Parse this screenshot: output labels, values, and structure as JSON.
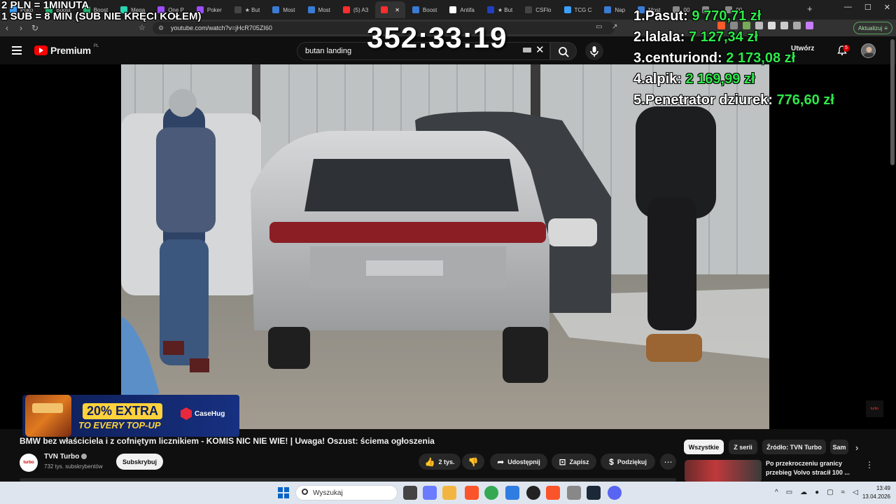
{
  "browser": {
    "tabs": [
      {
        "label": "Poko",
        "active": false,
        "color": "#3aa0ff"
      },
      {
        "label": "Boost",
        "active": false,
        "color": "#1db36a"
      },
      {
        "label": "Boost",
        "active": false,
        "color": "#1db36a"
      },
      {
        "label": "Mega",
        "active": false,
        "color": "#2ad4b0"
      },
      {
        "label": "One P",
        "active": false,
        "color": "#9b4dff"
      },
      {
        "label": "Poker",
        "active": false,
        "color": "#9b4dff"
      },
      {
        "label": "★ But",
        "active": false,
        "color": "#444444"
      },
      {
        "label": "Most",
        "active": false,
        "color": "#3a7bd5"
      },
      {
        "label": "Most",
        "active": false,
        "color": "#3a7bd5"
      },
      {
        "label": "(5) A3",
        "active": false,
        "color": "#ff2d2d"
      },
      {
        "label": "",
        "active": true,
        "color": "#ff2d2d"
      },
      {
        "label": "Boost",
        "active": false,
        "color": "#3a7bd5"
      },
      {
        "label": "Antifa",
        "active": false,
        "color": "#ffffff"
      },
      {
        "label": "★ But",
        "active": false,
        "color": "#2040c0"
      },
      {
        "label": "CSFlo",
        "active": false,
        "color": "#444444"
      },
      {
        "label": "TCG C",
        "active": false,
        "color": "#3aa0ff"
      },
      {
        "label": "Nap",
        "active": false,
        "color": "#3a7bd5"
      },
      {
        "label": "Most",
        "active": false,
        "color": "#3a7bd5"
      },
      {
        "label": "00",
        "active": false,
        "color": "#888888"
      },
      {
        "label": "",
        "active": false,
        "color": "#888888"
      },
      {
        "label": "00",
        "active": false,
        "color": "#888888"
      }
    ],
    "url": "youtube.com/watch?v=jHcR705ZI60",
    "update_label": "Aktualizuj"
  },
  "overlay": {
    "promo_line1": "2 PLN =  1MINUTA",
    "promo_line2": "1 SUB = 8 MIN (SUB NIE KRĘCI KOŁEM)",
    "timer": "352:33:19",
    "leaderboard": [
      {
        "rank": "1.",
        "name": "Pasut:",
        "amount": "9 770,71 zł"
      },
      {
        "rank": "2.",
        "name": "lalala:",
        "amount": "7 127,34 zł"
      },
      {
        "rank": "3.",
        "name": "centuriond:",
        "amount": "2 173,08 zł"
      },
      {
        "rank": "4.",
        "name": "alpik:",
        "amount": "2 169,99 zł"
      },
      {
        "rank": "5.",
        "name": "Penetrator dziurek:",
        "amount": "776,60 zł"
      }
    ]
  },
  "youtube": {
    "logo_text": "Premium",
    "region": "PL",
    "search_query": "butan landing",
    "create_label": "Utwórz",
    "notification_count": "5",
    "watermark": "turbo"
  },
  "ad": {
    "badge": "20% EXTRA",
    "line2": "TO EVERY TOP-UP",
    "brand": "CaseHug"
  },
  "video": {
    "title": "BMW bez właściciela i z cofniętym licznikiem - KOMIS NIC NIE WIE! | Uwaga! Oszust: ściema ogłoszenia",
    "channel_name": "TVN Turbo",
    "channel_avatar_text": "turbo",
    "subscribers": "732 tys. subskrybentów",
    "subscribe_label": "Subskrybuj",
    "likes": "2 tys.",
    "share_label": "Udostępnij",
    "save_label": "Zapisz",
    "thanks_label": "Podziękuj"
  },
  "sidebar": {
    "chips": [
      "Wszystkie",
      "Z serii",
      "Źródło: TVN Turbo",
      "Sam"
    ],
    "recommendation_title": "Po przekroczeniu granicy przebieg Volvo stracił 100 ..."
  },
  "taskbar": {
    "search_placeholder": "Wyszukaj",
    "time": "13:49",
    "date": "13.04.2026"
  }
}
